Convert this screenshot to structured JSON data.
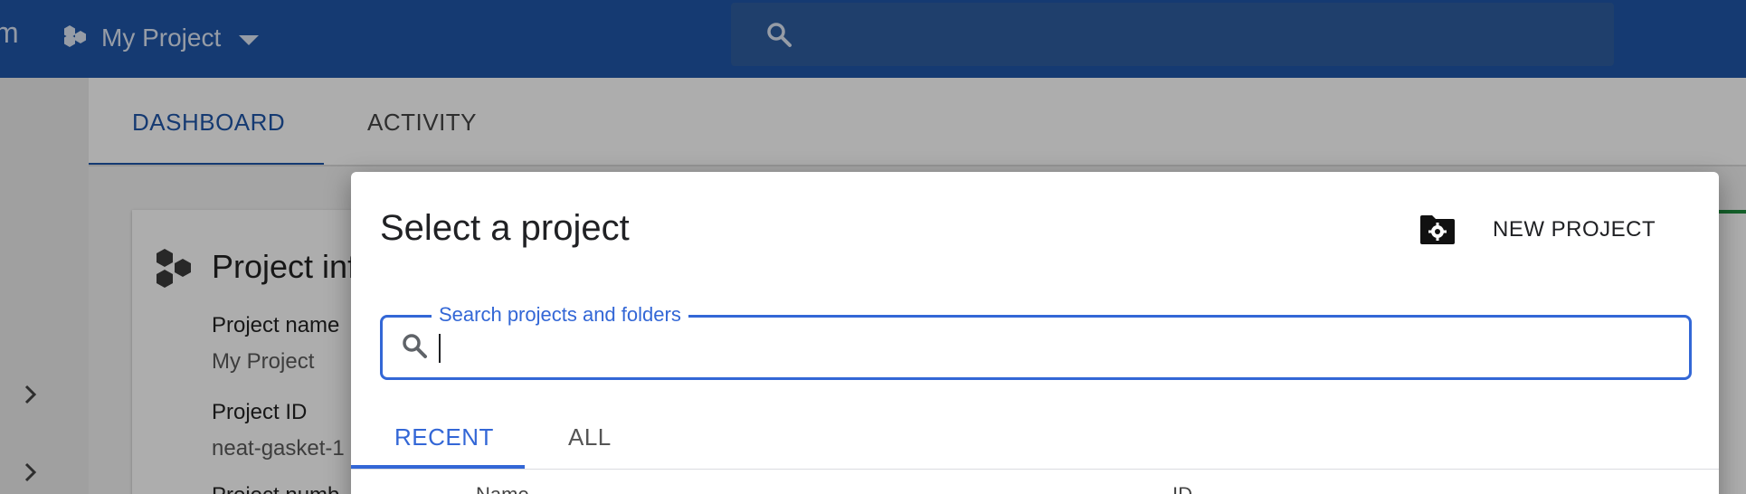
{
  "topbar": {
    "brand_fragment": "m",
    "project_name": "My Project",
    "search_icon": "search-icon",
    "color": "#1f56a8"
  },
  "background": {
    "tabs": [
      {
        "label": "DASHBOARD",
        "active": true
      },
      {
        "label": "ACTIVITY",
        "active": false
      }
    ],
    "card": {
      "title": "Project inf",
      "fields": [
        {
          "label": "Project name",
          "value": "My Project"
        },
        {
          "label": "Project ID",
          "value": "neat-gasket-1"
        },
        {
          "label": "Project numb",
          "value": ""
        }
      ]
    }
  },
  "dialog": {
    "title": "Select a project",
    "new_project_label": "NEW PROJECT",
    "new_project_icon": "folder-settings-icon",
    "search": {
      "label": "Search projects and folders",
      "value": "",
      "placeholder": ""
    },
    "tabs": [
      {
        "label": "RECENT",
        "active": true
      },
      {
        "label": "ALL",
        "active": false
      }
    ],
    "table_headers": [
      "Name",
      "ID"
    ],
    "accent": "#3367d6"
  }
}
